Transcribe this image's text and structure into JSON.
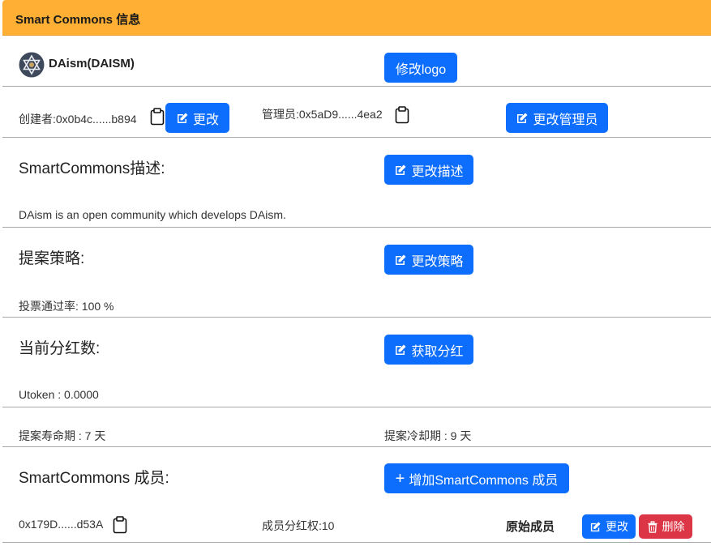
{
  "header": {
    "title": "Smart Commons 信息"
  },
  "token": {
    "name": "DAism(DAISM)"
  },
  "buttons": {
    "edit_logo": "修改logo",
    "change_creator": "更改",
    "change_admin": "更改管理员",
    "change_desc": "更改描述",
    "change_policy": "更改策略",
    "get_dividend": "获取分红",
    "add_member": "增加SmartCommons 成员",
    "member_edit": "更改",
    "member_delete": "删除"
  },
  "creator": {
    "label": "创建者:0x0b4c......b894"
  },
  "admin": {
    "label": "管理员:0x5aD9......4ea2"
  },
  "description": {
    "heading": "SmartCommons描述:",
    "text": "DAism is an open community which develops DAism."
  },
  "policy": {
    "heading": "提案策略:",
    "text": "投票通过率: 100 %"
  },
  "dividend": {
    "heading": "当前分红数:",
    "text": "Utoken : 0.0000"
  },
  "periods": {
    "lifetime": "提案寿命期 : 7 天",
    "cooldown": "提案冷却期 : 9 天"
  },
  "members": {
    "heading": "SmartCommons 成员:",
    "list": [
      {
        "address": "0x179D......d53A",
        "share": "成员分红权:10",
        "role": "原始成员"
      }
    ]
  },
  "colors": {
    "header": "#ffaf33",
    "primary": "#0d6efd",
    "danger": "#dc3545"
  }
}
